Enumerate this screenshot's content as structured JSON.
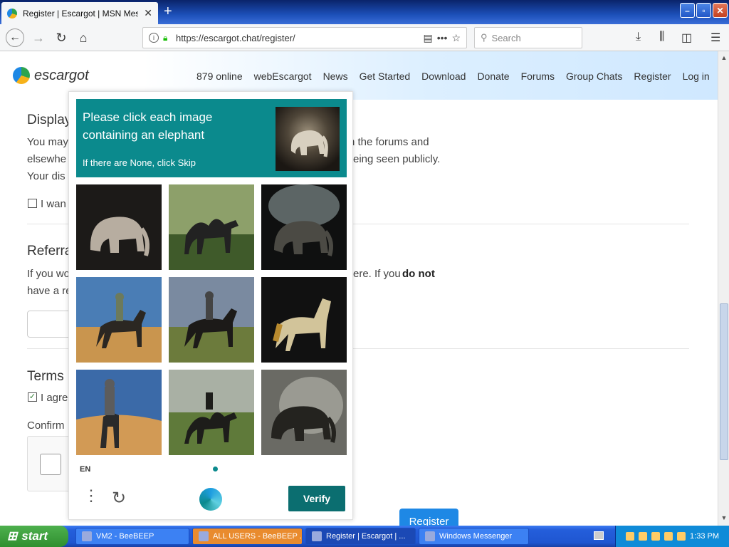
{
  "browser": {
    "tab_title": "Register | Escargot | MSN Messenger",
    "new_tab": "+",
    "url": "https://escargot.chat/register/",
    "search_placeholder": "Search",
    "window_buttons": {
      "minimize": "–",
      "maximize": "▫",
      "close": "✕"
    }
  },
  "site": {
    "logo": "escargot",
    "nav": [
      "879 online",
      "webEscargot",
      "News",
      "Get Started",
      "Download",
      "Donate",
      "Forums",
      "Group Chats",
      "Register",
      "Log in"
    ]
  },
  "page": {
    "display_heading": "Display",
    "display_text_1": "You may",
    "display_text_1b": "n the forums and",
    "display_text_2": "elsewhe",
    "display_text_2b": "eing seen publicly.",
    "display_text_3": "Your dis",
    "display_checkbox": "I wan",
    "referral_heading": "Referra",
    "referral_text_1": "If you wo",
    "referral_text_1b": "ere. If you",
    "referral_text_bold": "do not",
    "referral_text_2": "have a re",
    "terms_heading": "Terms",
    "terms_checkbox": "I agre",
    "terms_checkmark": "✓",
    "confirm_label": "Confirm",
    "register_button": "Register"
  },
  "captcha": {
    "prompt": "Please click each image containing an elephant",
    "sub": "If there are None, click Skip",
    "language": "EN",
    "verify_label": "Verify",
    "tiles": [
      "elephant",
      "camel",
      "elephant",
      "horse-rider",
      "horse-rider",
      "horse",
      "horse-rider",
      "camel",
      "elephant"
    ]
  },
  "taskbar": {
    "start": "start",
    "items": [
      {
        "label": "VM2 - BeeBEEP"
      },
      {
        "label": "ALL USERS - BeeBEEP ..."
      },
      {
        "label": "Register | Escargot | ..."
      },
      {
        "label": "Windows Messenger"
      }
    ],
    "clock": "1:33 PM"
  }
}
